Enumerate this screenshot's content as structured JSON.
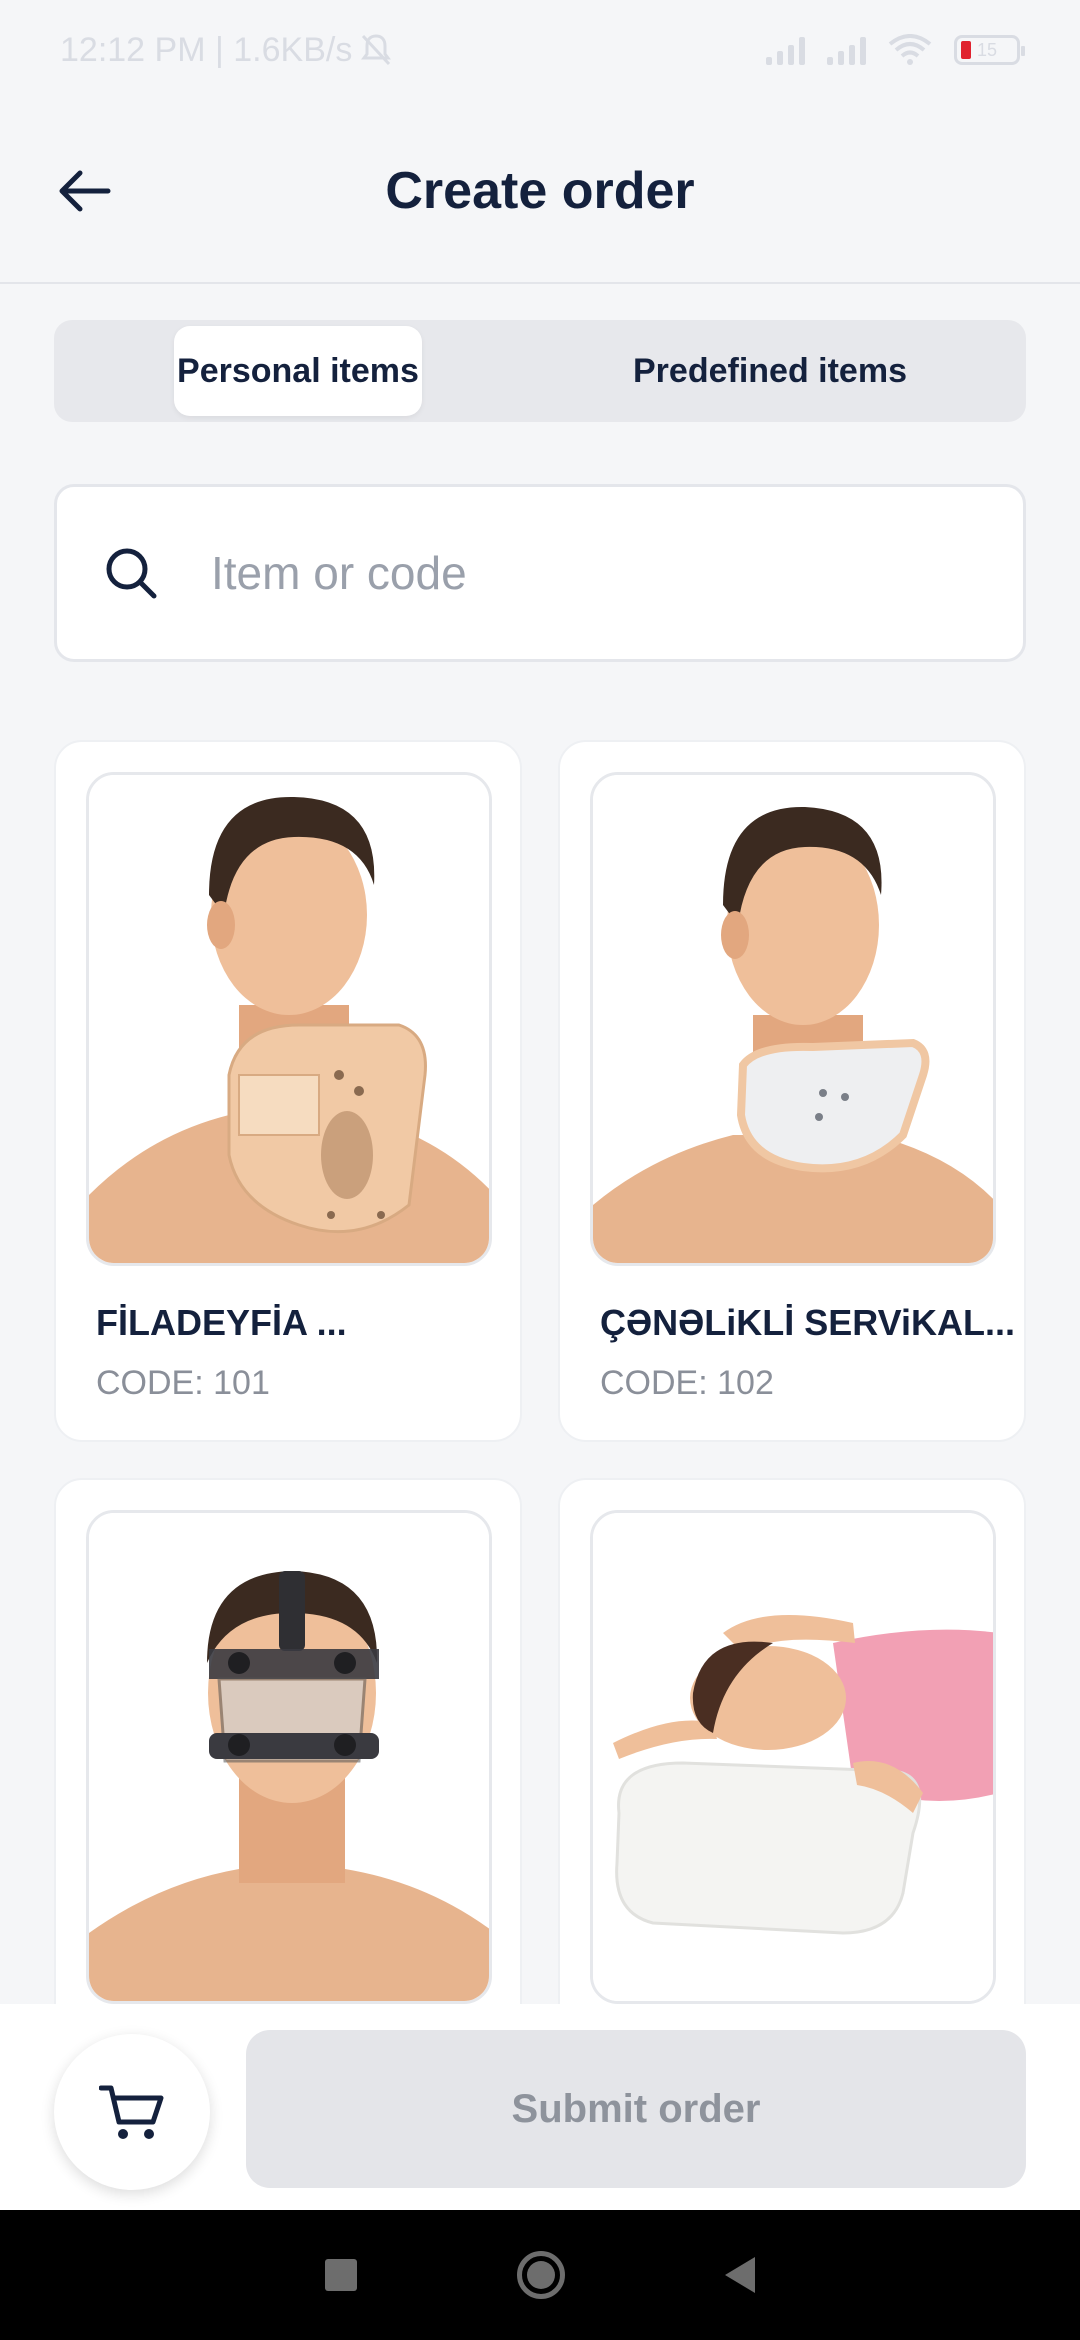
{
  "status_bar": {
    "time_speed": "12:12 PM | 1.6KB/s",
    "battery": "15"
  },
  "header": {
    "title": "Create order",
    "back_icon": "arrow-left-icon"
  },
  "tabs": [
    {
      "label": "Personal items",
      "active": true
    },
    {
      "label": "Predefined items",
      "active": false
    }
  ],
  "search": {
    "placeholder": "Item or code",
    "value": "",
    "icon": "search-icon"
  },
  "items": [
    {
      "title": "FİLADEYFİA ...",
      "code": "CODE: 101",
      "image": "cervical-collar-philadelphia"
    },
    {
      "title": "ÇƏNƏLiKLİ SERViKAL...",
      "code": "CODE: 102",
      "image": "cervical-collar-chin"
    },
    {
      "title": "",
      "code": "",
      "image": "nasal-protection-mask"
    },
    {
      "title": "",
      "code": "",
      "image": "orthopedic-pillow"
    }
  ],
  "bottom": {
    "cart_icon": "cart-icon",
    "submit_label": "Submit order"
  },
  "colors": {
    "text_primary": "#14213d",
    "background": "#f5f6f8",
    "disabled_button": "#e4e5e9",
    "collar_skin": "#f1c9a5"
  }
}
